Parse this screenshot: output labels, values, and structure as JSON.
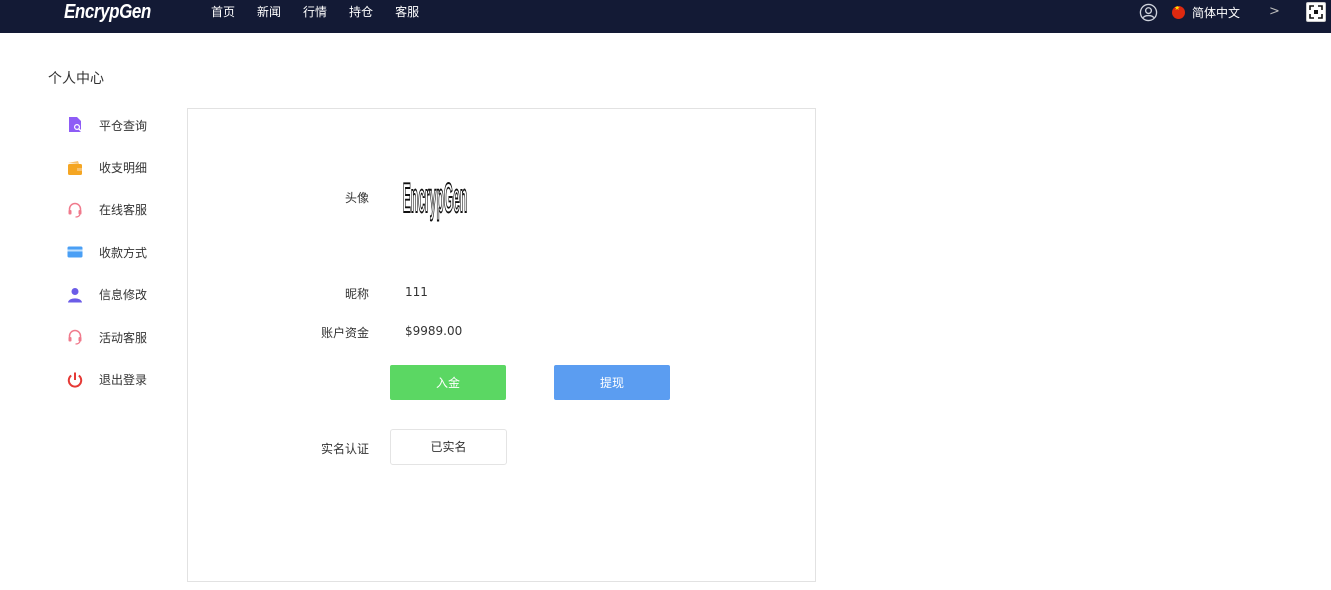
{
  "header": {
    "brand": "EncrypGen",
    "nav": [
      "首页",
      "新闻",
      "行情",
      "持仓",
      "客服"
    ],
    "language": "简体中文",
    "arrow": ">"
  },
  "page": {
    "title": "个人中心"
  },
  "sidebar": {
    "items": [
      {
        "label": "平仓查询",
        "icon": "file-search-icon",
        "color": "#8e5cf6"
      },
      {
        "label": "收支明细",
        "icon": "wallet-icon",
        "color": "#f5a623"
      },
      {
        "label": "在线客服",
        "icon": "headset-icon",
        "color": "#f07a8c"
      },
      {
        "label": "收款方式",
        "icon": "card-icon",
        "color": "#4a9ff5"
      },
      {
        "label": "信息修改",
        "icon": "user-icon",
        "color": "#6b5ce7"
      },
      {
        "label": "活动客服",
        "icon": "headset-icon",
        "color": "#f07a8c"
      },
      {
        "label": "退出登录",
        "icon": "power-icon",
        "color": "#e53935"
      }
    ]
  },
  "profile": {
    "avatar_label": "头像",
    "avatar_text": "EncrypGen",
    "nickname_label": "昵称",
    "nickname": "111",
    "balance_label": "账户资金",
    "balance": "$9989.00",
    "deposit_label": "入金",
    "withdraw_label": "提现",
    "verify_label": "实名认证",
    "verify_status": "已实名"
  },
  "colors": {
    "topbar": "#131a35",
    "deposit": "#5bd763",
    "withdraw": "#5b9df1"
  }
}
